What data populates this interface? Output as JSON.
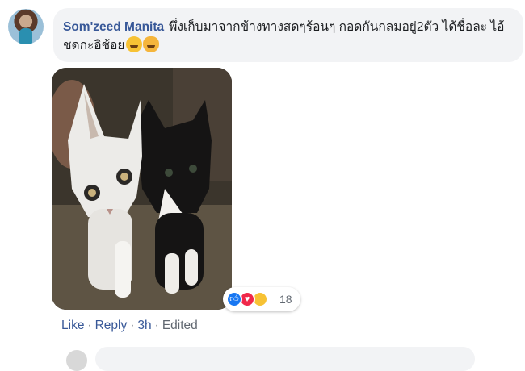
{
  "comment": {
    "author": "Som'zeed Manita",
    "text": "พึ่งเก็บมาจากข้างทางสดๆร้อนๆ กอดกันกลมอยู่2ตัว ได้ชื่อละ ไอ้ชดกะอิช้อย",
    "emojis": [
      "grinning-face-emoji",
      "smiling-cat-emoji"
    ]
  },
  "reactions": {
    "icons": [
      "like-icon",
      "love-icon",
      "haha-icon"
    ],
    "count": "18"
  },
  "actions": {
    "like": "Like",
    "reply": "Reply",
    "time": "3h",
    "edited": "Edited",
    "separator": "·"
  },
  "colors": {
    "author": "#385898",
    "bubble": "#f2f3f5",
    "like_blue": "#1877f2",
    "love_red": "#f0284a",
    "haha_yellow": "#f7c234"
  }
}
